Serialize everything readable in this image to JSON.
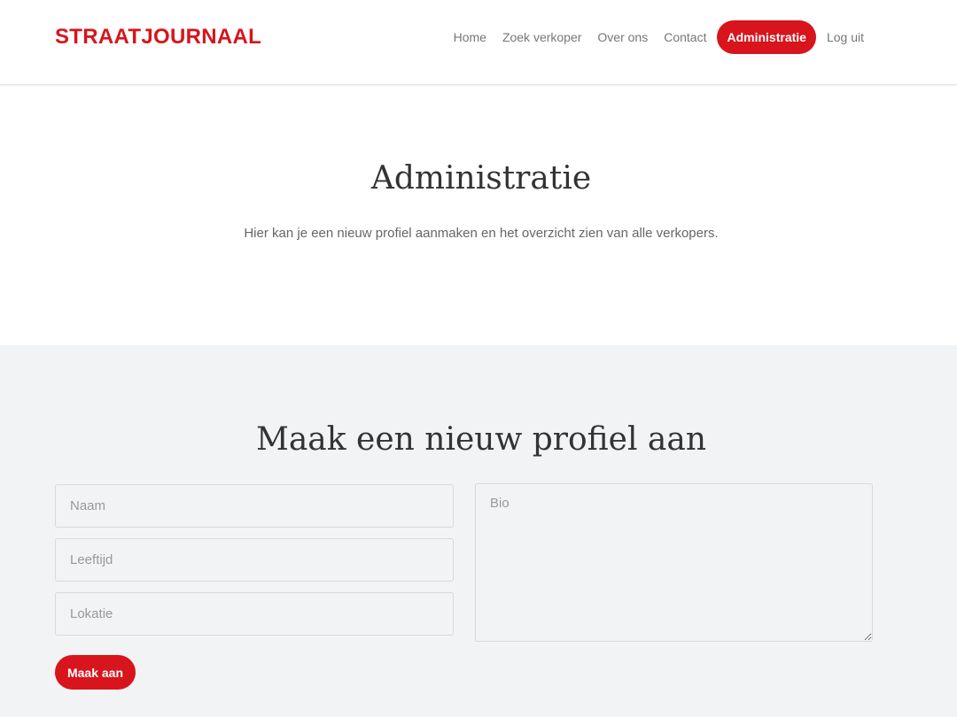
{
  "header": {
    "brand": "STRAATJOURNAAL",
    "nav": [
      {
        "label": "Home",
        "active": false
      },
      {
        "label": "Zoek verkoper",
        "active": false
      },
      {
        "label": "Over ons",
        "active": false
      },
      {
        "label": "Contact",
        "active": false
      },
      {
        "label": "Administratie",
        "active": true
      },
      {
        "label": "Log uit",
        "active": false
      }
    ]
  },
  "hero": {
    "title": "Administratie",
    "subtitle": "Hier kan je een nieuw profiel aanmaken en het overzicht zien van alle verkopers."
  },
  "form": {
    "title": "Maak een nieuw profiel aan",
    "naam_placeholder": "Naam",
    "leeftijd_placeholder": "Leeftijd",
    "lokatie_placeholder": "Lokatie",
    "bio_placeholder": "Bio",
    "submit_label": "Maak aan"
  },
  "colors": {
    "accent": "#d8141c",
    "section_bg": "#f2f3f5",
    "nav_text": "#777777"
  }
}
